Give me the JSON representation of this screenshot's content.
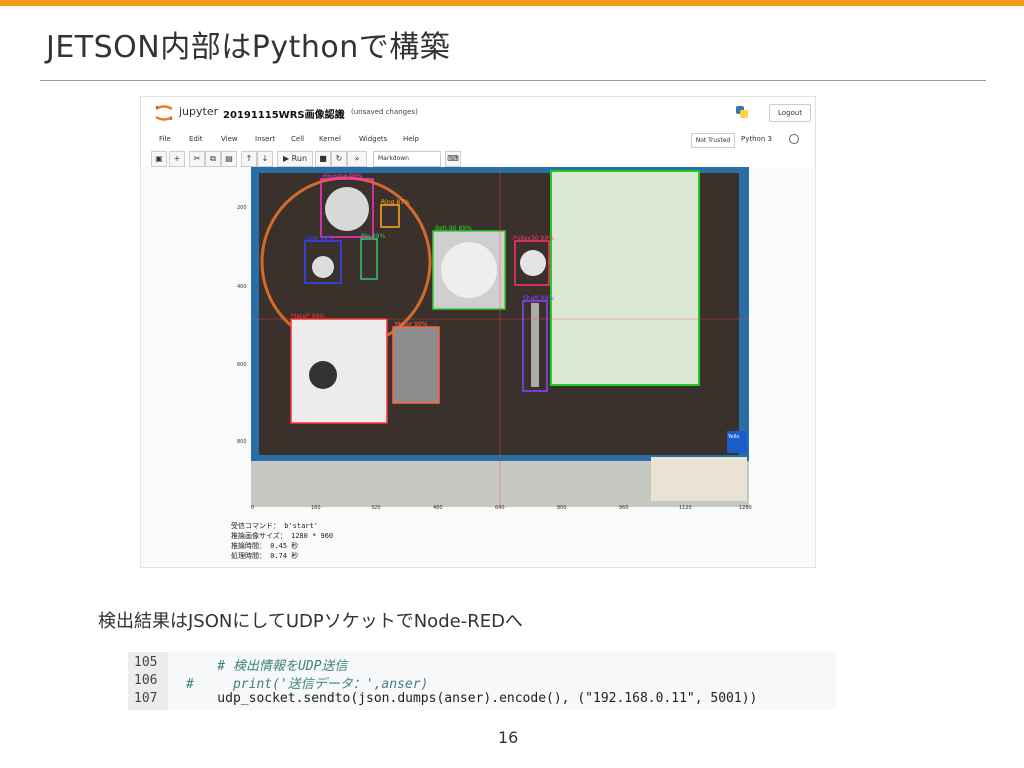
{
  "slide": {
    "title": "JETSON内部はPythonで構築",
    "caption": "検出結果はJSONにしてUDPソケットでNode-REDへ",
    "page_number": "16",
    "accent_color": "#f39c1a"
  },
  "jupyter": {
    "logo_text": "jupyter",
    "notebook_name": "20191115WRS画像認識",
    "unsaved": "(unsaved changes)",
    "logout": "Logout",
    "menu": [
      "File",
      "Edit",
      "View",
      "Insert",
      "Cell",
      "Kernel",
      "Widgets",
      "Help"
    ],
    "not_trusted": "Not Trusted",
    "kernel": "Python 3",
    "toolbar": {
      "run": "Run",
      "cell_type": "Markdown"
    },
    "plot": {
      "y_ticks": [
        "200",
        "400",
        "600",
        "800"
      ],
      "x_ticks": [
        "0",
        "160",
        "320",
        "480",
        "640",
        "800",
        "960",
        "1120",
        "1280"
      ],
      "labels": [
        "Housing 99%",
        "Ring 87%",
        "Belt-90 89%",
        "Idler 99%",
        "Pin 99%",
        "Pulley30 99%",
        "Shaft 99%",
        "PlateP 99%",
        "Motor 99%",
        "Yello"
      ]
    },
    "output": [
      "受信コマンド： b'start'",
      "推論画像サイズ： 1280 * 960",
      "推論時間： 0.45 秒",
      "処理時間： 0.74 秒"
    ]
  },
  "code": {
    "lines": [
      {
        "num": "105",
        "text": "    # 検出情報をUDP送信"
      },
      {
        "num": "106",
        "text": "#     print('送信データ：',anser)"
      },
      {
        "num": "107",
        "text": "    udp_socket.sendto(json.dumps(anser).encode(), (\"192.168.0.11\", 5001))"
      }
    ]
  }
}
